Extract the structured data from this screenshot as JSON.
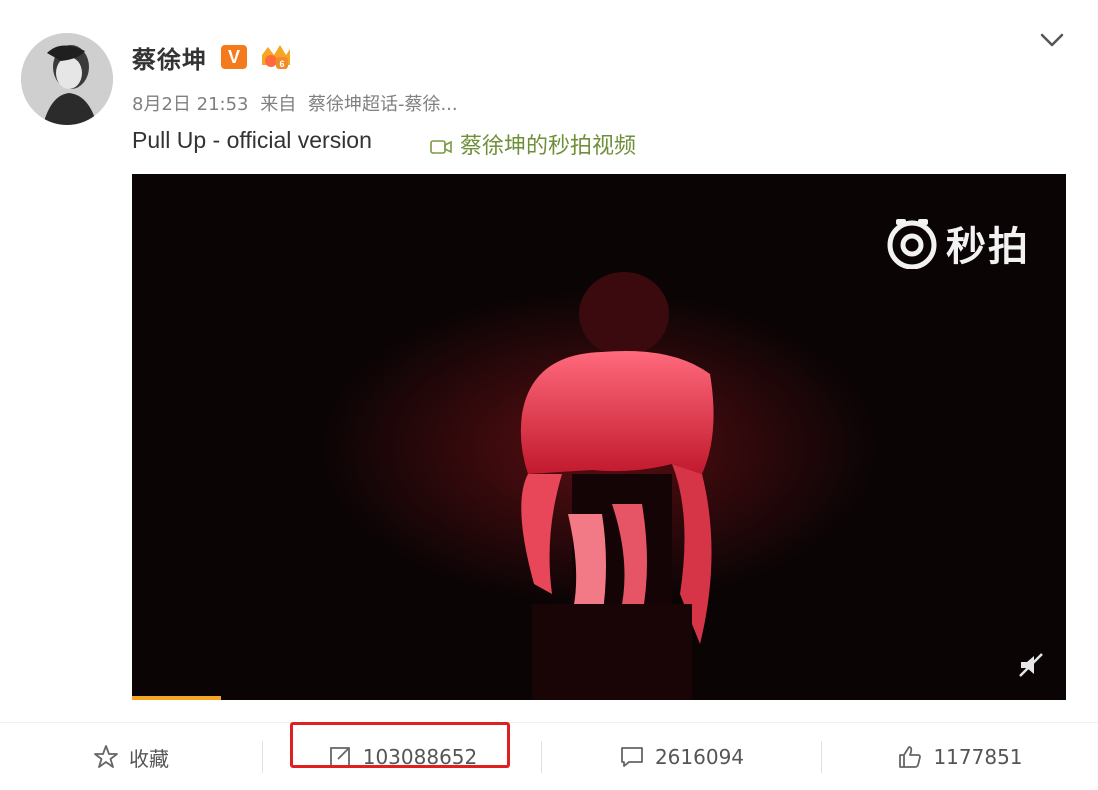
{
  "post": {
    "author": "蔡徐坤",
    "verified_badge": "V",
    "meta": {
      "date": "8月2日 21:53",
      "source_prefix": "来自",
      "source": "蔡徐坤超话-蔡徐..."
    },
    "text": "Pull Up - official version",
    "video_link": "蔡徐坤的秒拍视频",
    "video": {
      "watermark": "秒拍",
      "progress_fraction": 0.095
    }
  },
  "actions": {
    "favorite": {
      "label": "收藏"
    },
    "repost": {
      "count": "103088652"
    },
    "comment": {
      "count": "2616094"
    },
    "like": {
      "count": "1177851"
    }
  },
  "colors": {
    "verified_badge": "#f37b1d",
    "video_link": "#6f8f3a",
    "highlight_box": "#e02020",
    "progress": "#f5a623"
  },
  "icons": [
    "chevron-down-icon",
    "video-camera-icon",
    "miaopai-logo-icon",
    "mute-icon",
    "star-icon",
    "repost-icon",
    "comment-icon",
    "thumbs-up-icon"
  ]
}
